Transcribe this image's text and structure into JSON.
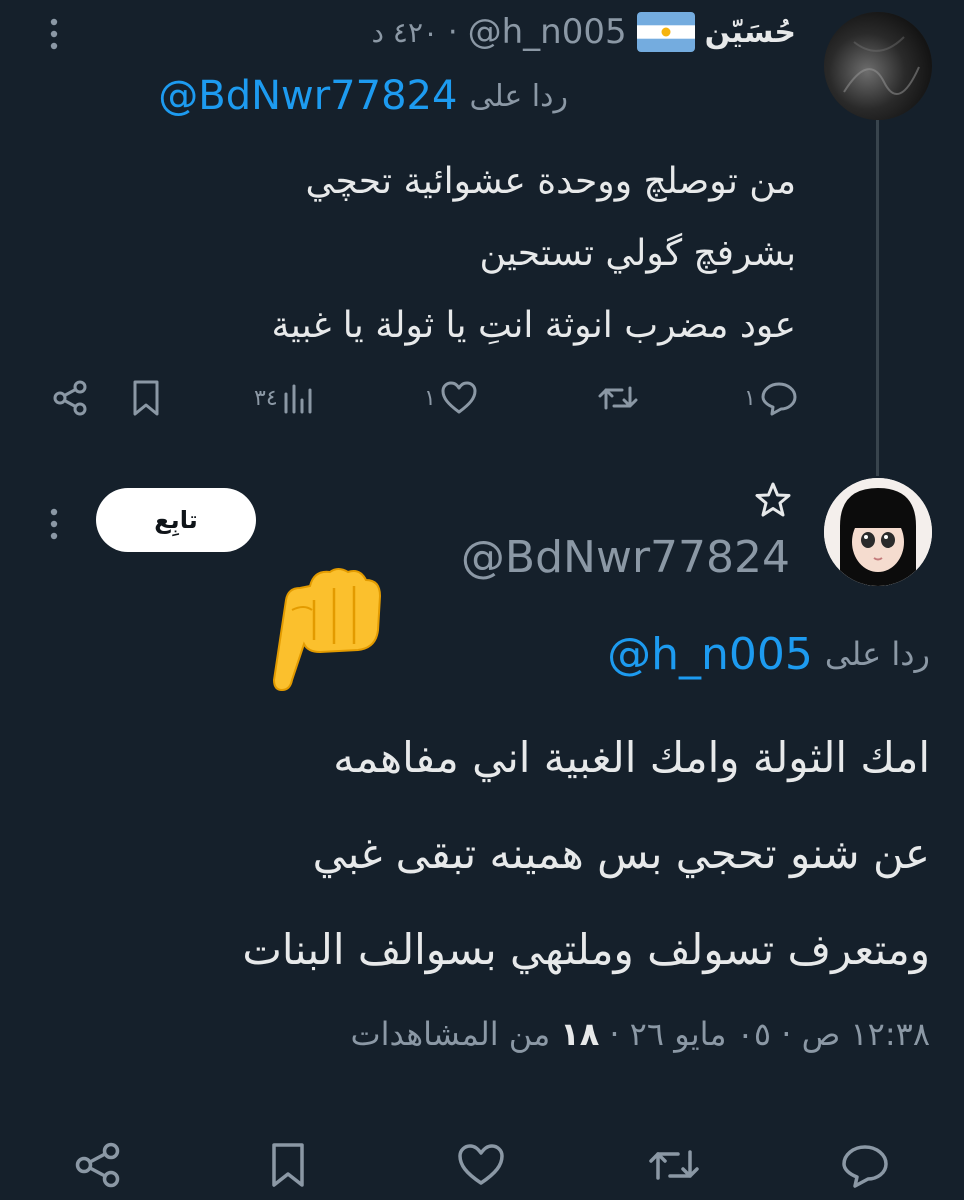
{
  "tweet1": {
    "display_name": "حُسَيّن",
    "handle": "@h_n005",
    "time": "٤٢٠ د",
    "reply_prefix": "ردا على",
    "reply_to": "@BdNwr77824",
    "lines": [
      "من توصلچ ووحدة عشوائية تحچي",
      "بشرفچ گولي تستحين",
      "عود مضرب انوثة انتِ يا ثولة يا غبية"
    ],
    "replies": "١",
    "retweets": "",
    "likes": "١",
    "views": "٣٤"
  },
  "tweet2": {
    "handle": "@BdNwr77824",
    "follow_label": "تابِع",
    "reply_prefix": "ردا على",
    "reply_to": "@h_n005",
    "lines": [
      "امك الثولة وامك الغبية اني مفاهمه",
      "عن شنو تحجي بس همينه تبقى غبي",
      "ومتعرف تسولف وملتهي بسوالف البنات"
    ],
    "meta_time": "١٢:٣٨ ص · ٠٥ مايو ٢٦ ·",
    "meta_views_count": "١٨",
    "meta_views_label": "من المشاهدات"
  },
  "colors": {
    "background": "#15202b",
    "text": "#e7e9ea",
    "muted": "#8b98a5",
    "link": "#1d9bf0",
    "divider": "#38444d"
  }
}
